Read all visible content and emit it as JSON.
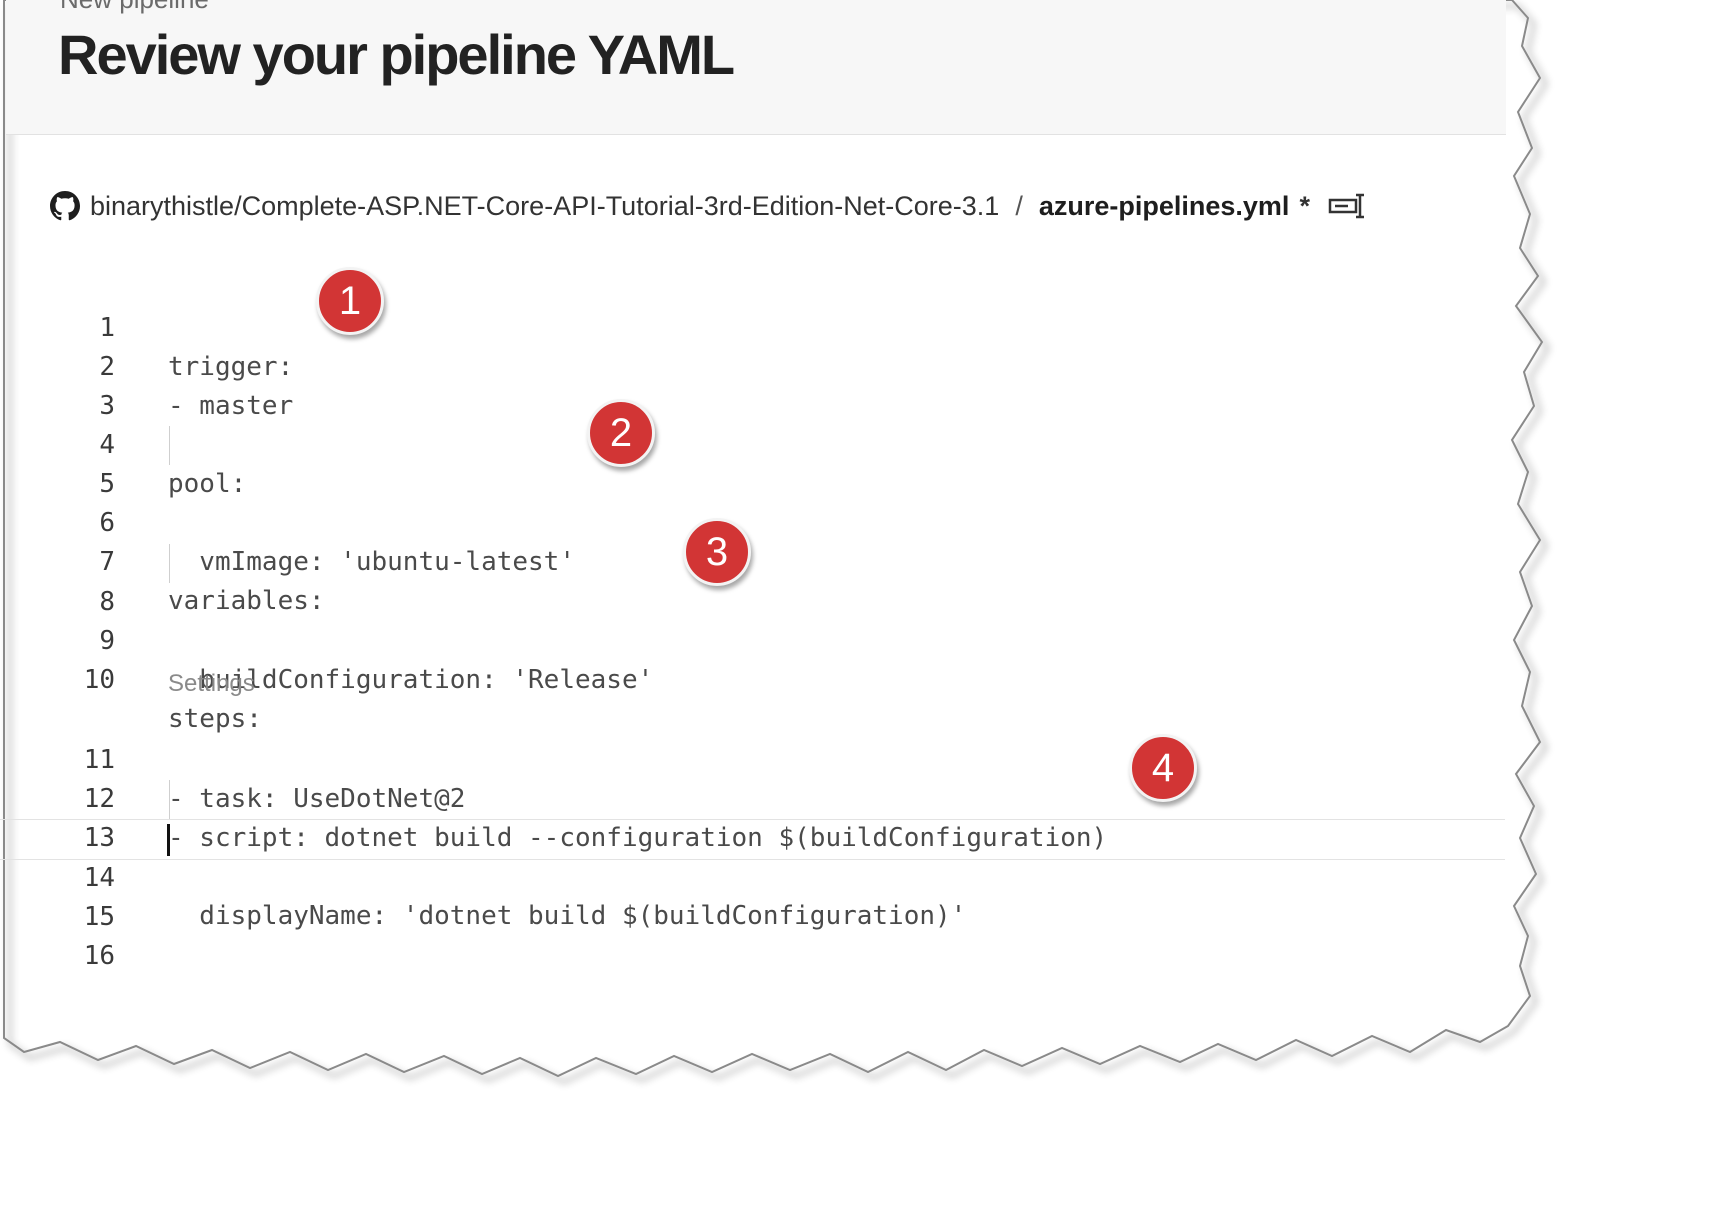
{
  "header": {
    "overline": "New pipeline",
    "title": "Review your pipeline YAML"
  },
  "breadcrumb": {
    "icon": "github-icon",
    "repository": "binarythistle/Complete-ASP.NET-Core-API-Tutorial-3rd-Edition-Net-Core-3.1",
    "separator": "/",
    "file": "azure-pipelines.yml",
    "dirty_marker": "*",
    "rename_icon": "rename-icon"
  },
  "editor": {
    "lines": [
      {
        "number": "1",
        "code": "trigger:"
      },
      {
        "number": "2",
        "code": "- master"
      },
      {
        "number": "3",
        "code": ""
      },
      {
        "number": "4",
        "code": "pool:"
      },
      {
        "number": "5",
        "code": "  vmImage: 'ubuntu-latest'"
      },
      {
        "number": "6",
        "code": ""
      },
      {
        "number": "7",
        "code": "variables:"
      },
      {
        "number": "8",
        "code": "  buildConfiguration: 'Release'"
      },
      {
        "number": "9",
        "code": ""
      },
      {
        "number": "10",
        "code": "steps:"
      },
      {
        "number": "11",
        "code": "- task: UseDotNet@2"
      },
      {
        "number": "12",
        "code": "- script: dotnet build --configuration $(buildConfiguration)"
      },
      {
        "number": "13",
        "code": "  displayName: 'dotnet build $(buildConfiguration)'"
      },
      {
        "number": "14",
        "code": ""
      },
      {
        "number": "15",
        "code": ""
      },
      {
        "number": "16",
        "code": ""
      }
    ],
    "codelens": "Settings",
    "current_line": "14"
  },
  "callouts": [
    "1",
    "2",
    "3",
    "4"
  ],
  "colors": {
    "callout": "#d23535",
    "code_text": "#4a4a4a",
    "header_background": "#f7f7f7"
  }
}
